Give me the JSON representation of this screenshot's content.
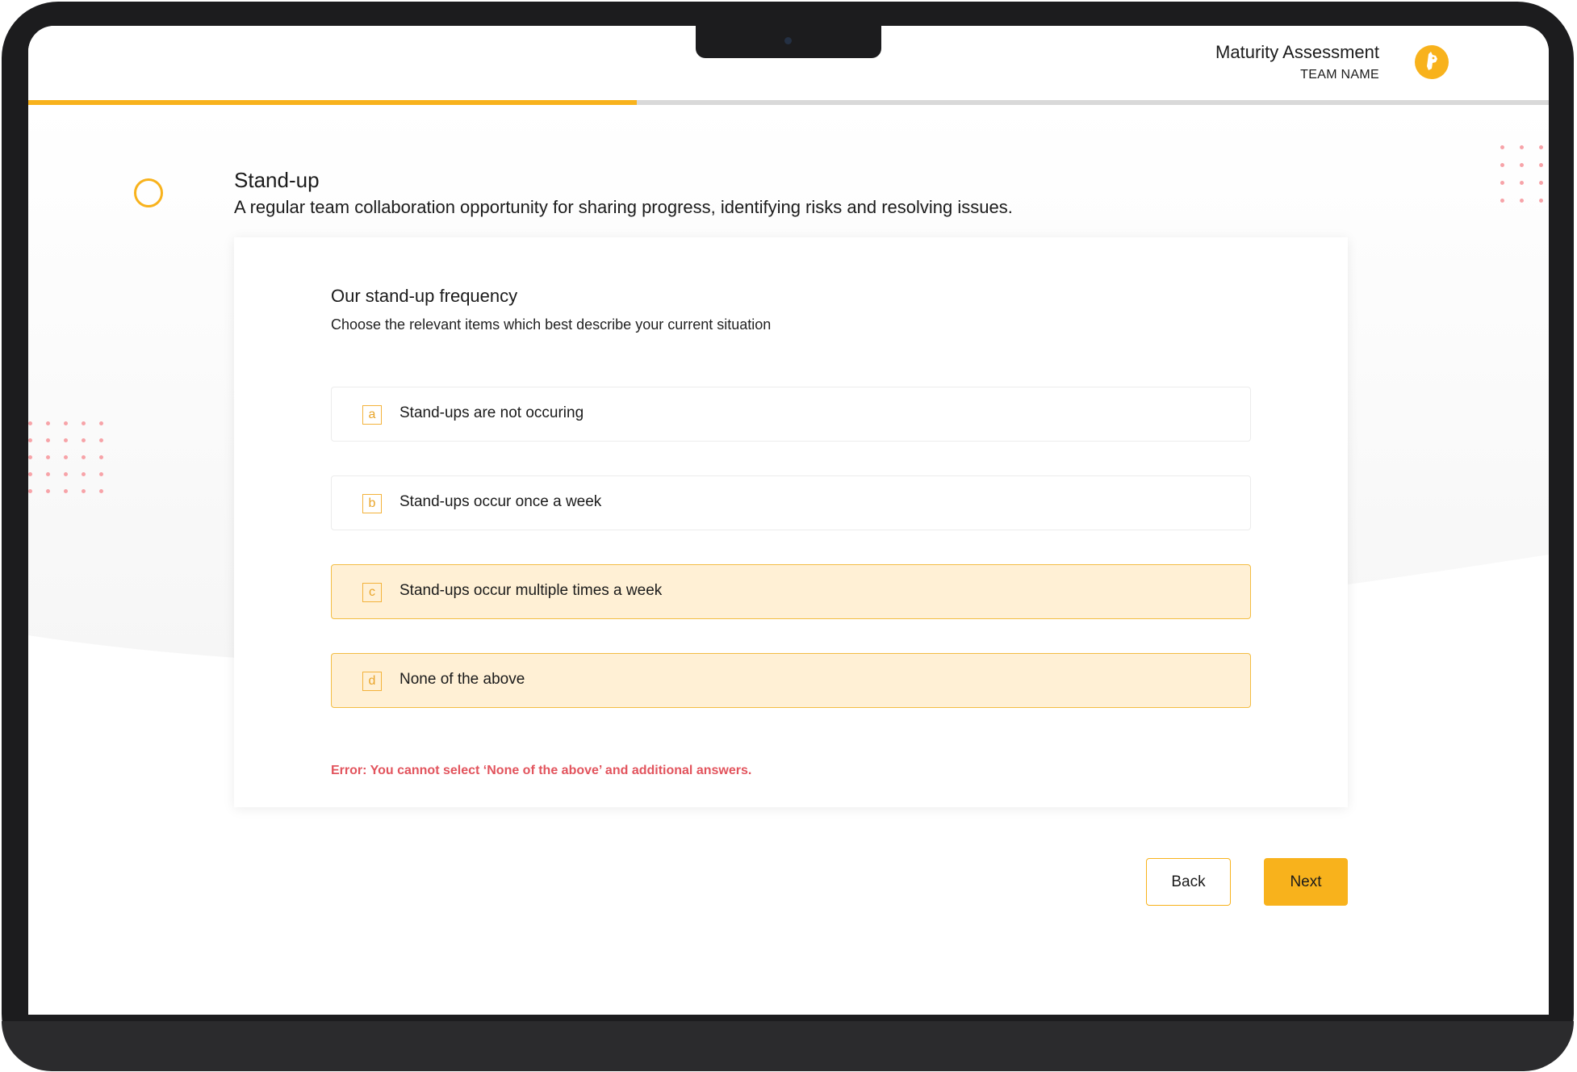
{
  "header": {
    "app_title": "Maturity Assessment",
    "team_name": "TEAM NAME",
    "logo_icon": "llama-logo-icon",
    "progress_percent": 40
  },
  "section": {
    "title": "Stand-up",
    "description": "A regular team collaboration opportunity for sharing progress, identifying risks and resolving issues.",
    "status_icon": "ring-icon"
  },
  "question": {
    "title": "Our stand-up frequency",
    "subtitle": "Choose the relevant items which best describe your current situation",
    "options": [
      {
        "letter": "a",
        "label": "Stand-ups are not occuring",
        "selected": false
      },
      {
        "letter": "b",
        "label": "Stand-ups occur once a week",
        "selected": false
      },
      {
        "letter": "c",
        "label": "Stand-ups occur multiple times a week",
        "selected": true
      },
      {
        "letter": "d",
        "label": "None of the above",
        "selected": true
      }
    ],
    "error": "Error: You cannot select ‘None of the above’ and additional answers."
  },
  "actions": {
    "back_label": "Back",
    "next_label": "Next"
  },
  "colors": {
    "accent": "#f8b21c",
    "selected_bg": "#fff0d5",
    "error": "#e2545d",
    "dots": "#f7a3a8"
  }
}
